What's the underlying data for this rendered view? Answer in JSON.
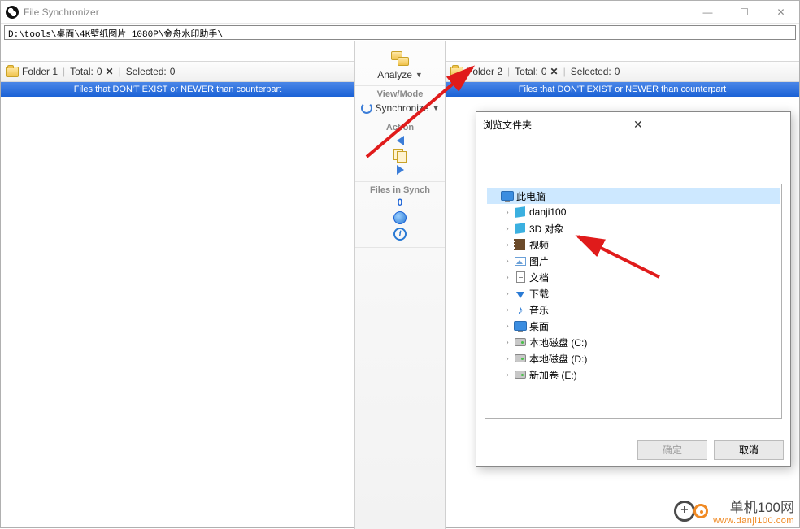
{
  "window": {
    "title": "File Synchronizer"
  },
  "pathbar": {
    "text": "D:\\tools\\桌面\\4K壁纸图片 1080P\\金舟水印助手\\"
  },
  "left": {
    "folder_label": "Folder 1",
    "total_label": "Total:",
    "total_value": "0",
    "selected_label": "Selected:",
    "selected_value": "0",
    "header": "Files that DON'T EXIST or NEWER than counterpart"
  },
  "right": {
    "folder_label": "Folder 2",
    "total_label": "Total:",
    "total_value": "0",
    "selected_label": "Selected:",
    "selected_value": "0",
    "header": "Files that DON'T EXIST or NEWER than counterpart"
  },
  "center": {
    "analyze": "Analyze",
    "viewmode_label": "View/Mode",
    "synchronize": "Synchronize",
    "action_label": "Action",
    "files_in_synch_label": "Files in Synch",
    "files_in_synch_value": "0"
  },
  "dialog": {
    "title": "浏览文件夹",
    "root": "此电脑",
    "items": [
      "danji100",
      "3D 对象",
      "视频",
      "图片",
      "文档",
      "下载",
      "音乐",
      "桌面",
      "本地磁盘 (C:)",
      "本地磁盘 (D:)",
      "新加卷 (E:)"
    ],
    "ok": "确定",
    "cancel": "取消"
  },
  "watermark": {
    "line1": "单机100网",
    "line2": "www.danji100.com"
  }
}
